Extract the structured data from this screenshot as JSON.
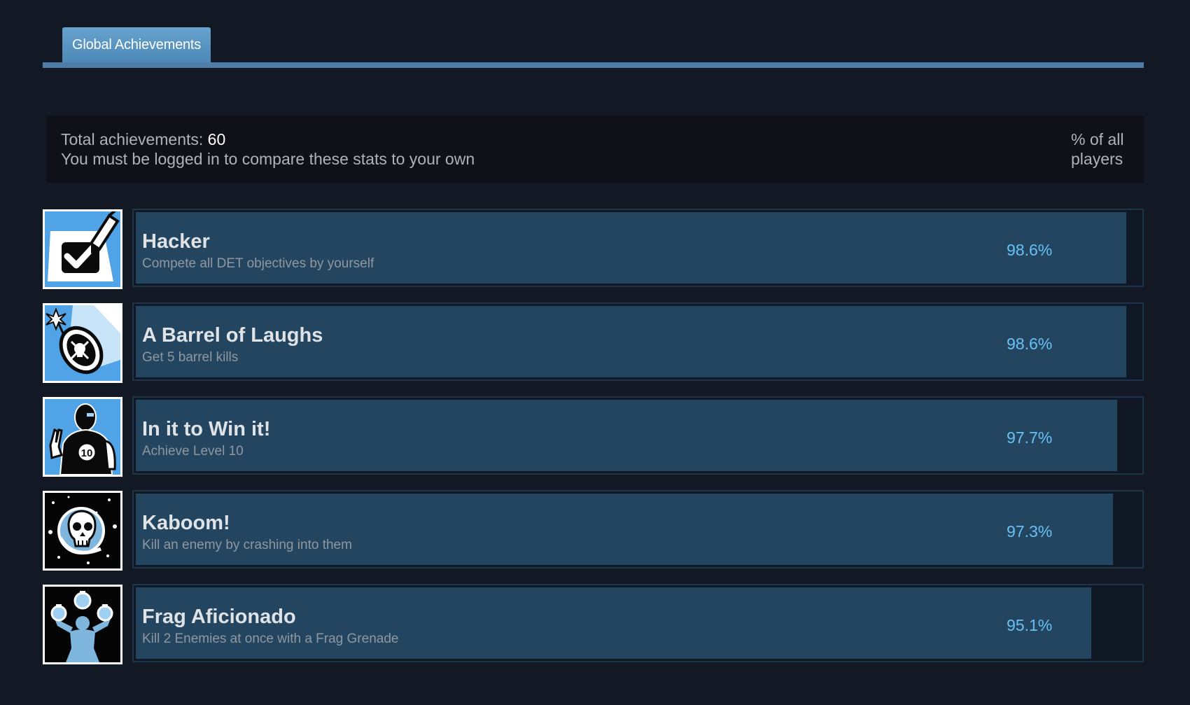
{
  "tabs": [
    {
      "label": "Global Achievements",
      "active": true
    }
  ],
  "summary": {
    "total_label": "Total achievements: ",
    "total_count": "60",
    "login_note": "You must be logged in to compare these stats to your own",
    "percent_header": "% of all players"
  },
  "colors": {
    "page_background": "#121924",
    "tab_active": "#5a96c4",
    "bar_fill": "#244560",
    "percent_text": "#67c1f5"
  },
  "achievements": [
    {
      "name": "Hacker",
      "description": "Compete all DET objectives by yourself",
      "percent_label": "98.6%",
      "percent": 98.6,
      "icon": "checkbox-marker-icon"
    },
    {
      "name": "A Barrel of Laughs",
      "description": "Get 5 barrel kills",
      "percent_label": "98.6%",
      "percent": 98.6,
      "icon": "skull-barrel-icon"
    },
    {
      "name": "In it to Win it!",
      "description": "Achieve Level 10",
      "percent_label": "97.7%",
      "percent": 97.7,
      "icon": "soldier-peace-sign-icon"
    },
    {
      "name": "Kaboom!",
      "description": "Kill an enemy by crashing into them",
      "percent_label": "97.3%",
      "percent": 97.3,
      "icon": "space-skull-helmet-icon"
    },
    {
      "name": "Frag Aficionado",
      "description": "Kill 2 Enemies at once with a Frag Grenade",
      "percent_label": "95.1%",
      "percent": 95.1,
      "icon": "juggling-grenades-icon"
    }
  ]
}
